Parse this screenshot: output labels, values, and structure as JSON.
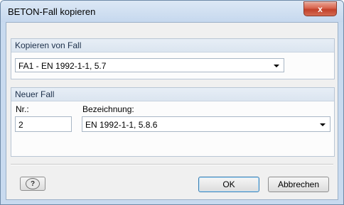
{
  "window": {
    "title": "BETON-Fall kopieren",
    "close_glyph": "x"
  },
  "copy_from": {
    "group_label": "Kopieren von Fall",
    "selected_case": "FA1 - EN 1992-1-1, 5.7"
  },
  "new_case": {
    "group_label": "Neuer Fall",
    "nr_label": "Nr.:",
    "nr_value": "2",
    "designation_label": "Bezeichnung:",
    "designation_value": "EN 1992-1-1, 5.8.6"
  },
  "buttons": {
    "help_glyph": "?",
    "ok_label": "OK",
    "cancel_label": "Abbrechen"
  },
  "colors": {
    "accent": "#3c7fb1",
    "close": "#c2412a"
  }
}
